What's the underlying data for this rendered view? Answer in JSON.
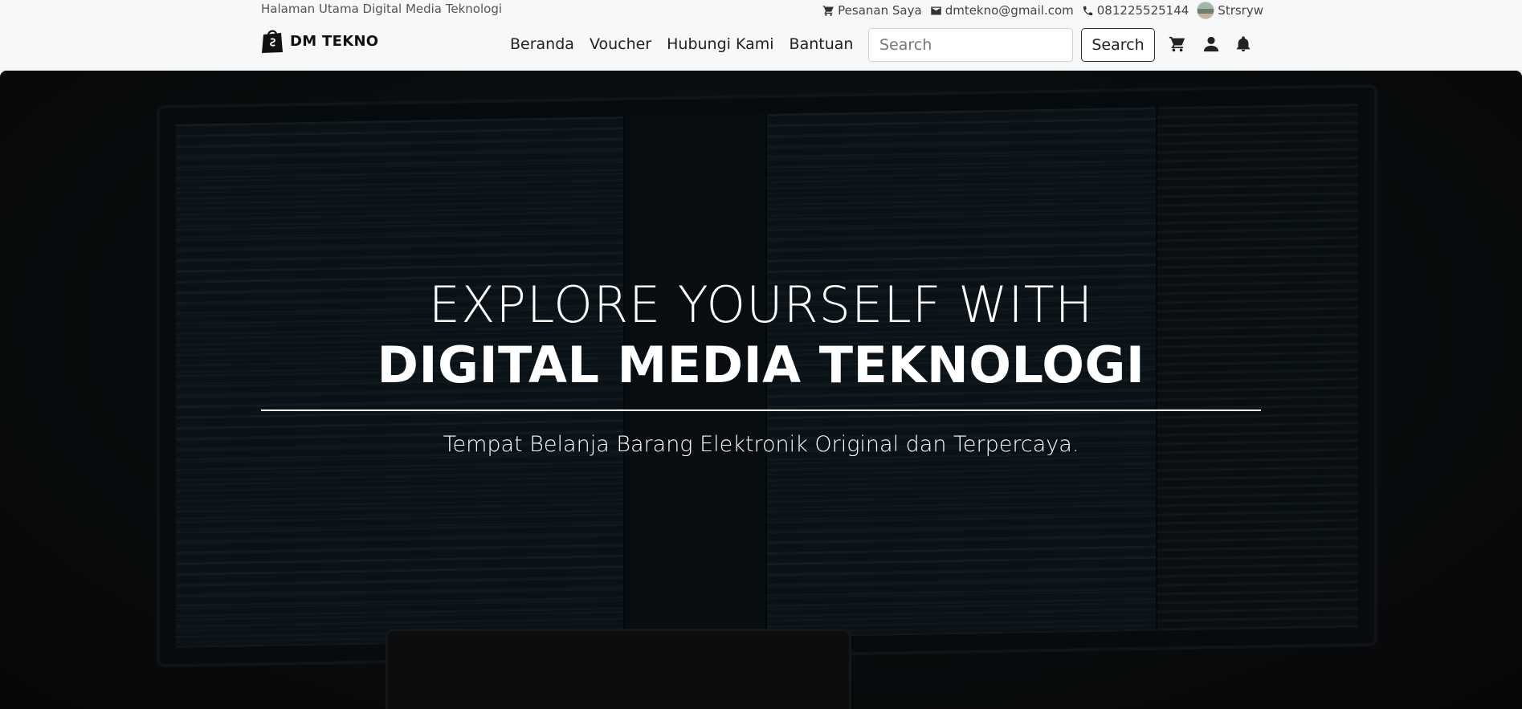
{
  "topbar": {
    "tagline": "Halaman Utama Digital Media Teknologi",
    "orders_label": "Pesanan Saya",
    "email": "dmtekno@gmail.com",
    "phone": "081225525144",
    "username": "Strsryw"
  },
  "navbar": {
    "brand": "DM TEKNO",
    "links": [
      "Beranda",
      "Voucher",
      "Hubungi Kami",
      "Bantuan"
    ],
    "search": {
      "placeholder": "Search",
      "value": "",
      "button_label": "Search"
    },
    "icons": [
      "cart-icon",
      "user-icon",
      "bell-icon"
    ]
  },
  "hero": {
    "headline_line1": "EXPLORE YOURSELF WITH",
    "headline_line2": "DIGITAL MEDIA TEKNOLOGI",
    "subtitle": "Tempat Belanja Barang Elektronik Original dan Terpercaya."
  },
  "colors": {
    "page_bg": "#f7f8fa",
    "hero_text": "#ffffff",
    "hero_bg": "#0b0d0f"
  }
}
